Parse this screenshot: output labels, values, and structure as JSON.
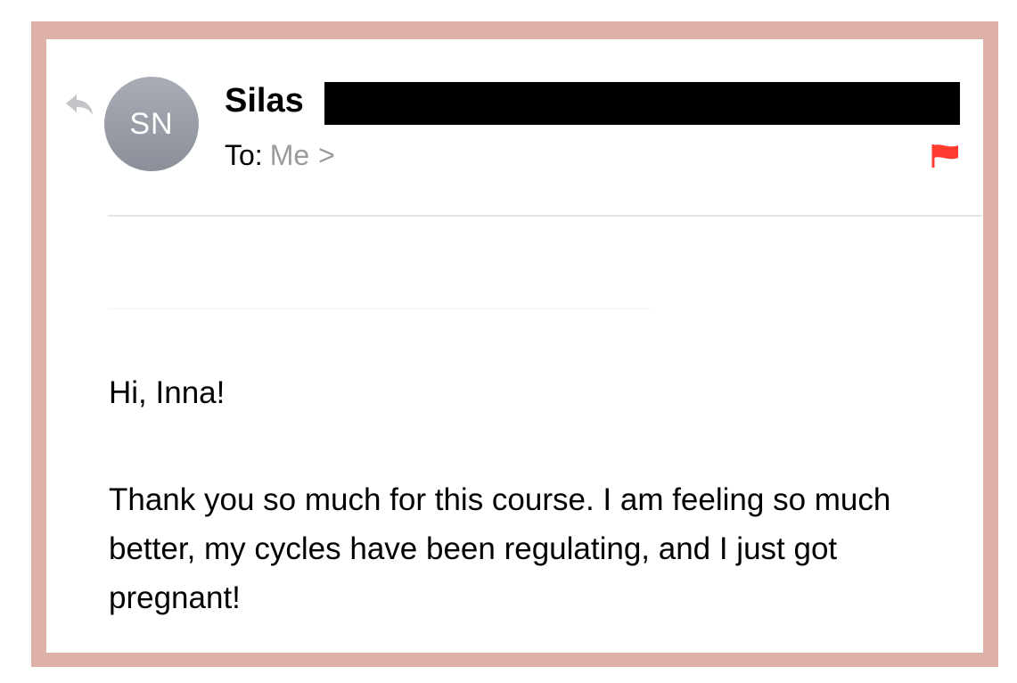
{
  "email": {
    "sender": {
      "avatar_initials": "SN",
      "name": "Silas"
    },
    "to_label": "To:",
    "recipient": "Me",
    "chevron": ">",
    "flagged": true,
    "greeting": "Hi, Inna!",
    "body": "Thank you so much for this course. I am feeling so much better, my cycles have been regulating, and I just got pregnant!"
  },
  "icons": {
    "reply": "reply-icon",
    "flag": "flag-icon"
  },
  "colors": {
    "frame_border": "#ddb1a5",
    "avatar": "#9a9ea7",
    "flag": "#ff3b30",
    "secondary_text": "#9b9b9b"
  }
}
